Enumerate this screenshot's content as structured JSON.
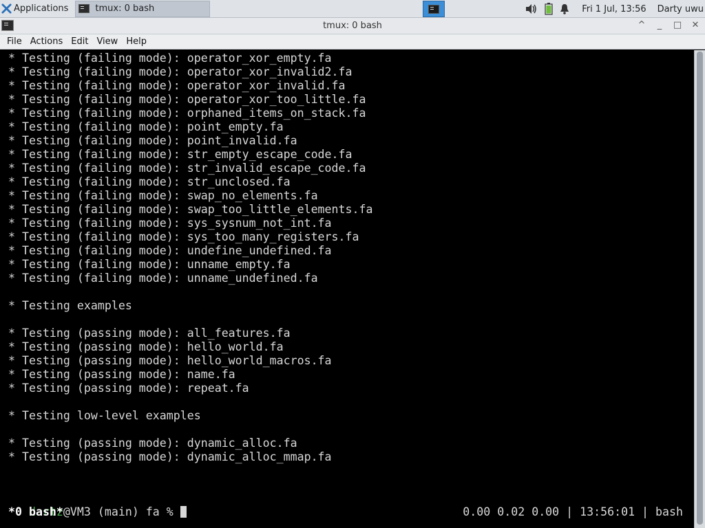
{
  "panel": {
    "apps_label": "Applications",
    "task_label": "tmux: 0 bash",
    "clock": "Fri  1 Jul, 13:56",
    "user": "Darty uwu",
    "icons": [
      "xfce-icon",
      "terminal-icon",
      "volume-icon",
      "battery-icon",
      "notification-bell-icon"
    ]
  },
  "window": {
    "title": "tmux: 0 bash",
    "controls": [
      "^",
      "_",
      "□",
      "✕"
    ]
  },
  "menu": {
    "items": [
      "File",
      "Actions",
      "Edit",
      "View",
      "Help"
    ]
  },
  "terminal": {
    "lines": [
      " * Testing (failing mode): operator_xor_empty.fa",
      " * Testing (failing mode): operator_xor_invalid2.fa",
      " * Testing (failing mode): operator_xor_invalid.fa",
      " * Testing (failing mode): operator_xor_too_little.fa",
      " * Testing (failing mode): orphaned_items_on_stack.fa",
      " * Testing (failing mode): point_empty.fa",
      " * Testing (failing mode): point_invalid.fa",
      " * Testing (failing mode): str_empty_escape_code.fa",
      " * Testing (failing mode): str_invalid_escape_code.fa",
      " * Testing (failing mode): str_unclosed.fa",
      " * Testing (failing mode): swap_no_elements.fa",
      " * Testing (failing mode): swap_too_little_elements.fa",
      " * Testing (failing mode): sys_sysnum_not_int.fa",
      " * Testing (failing mode): sys_too_many_registers.fa",
      " * Testing (failing mode): undefine_undefined.fa",
      " * Testing (failing mode): unname_empty.fa",
      " * Testing (failing mode): unname_undefined.fa",
      "",
      " * Testing examples",
      "",
      " * Testing (passing mode): all_features.fa",
      " * Testing (passing mode): hello_world.fa",
      " * Testing (passing mode): hello_world_macros.fa",
      " * Testing (passing mode): name.fa",
      " * Testing (passing mode): repeat.fa",
      "",
      " * Testing low-level examples",
      "",
      " * Testing (passing mode): dynamic_alloc.fa",
      " * Testing (passing mode): dynamic_alloc_mmap.fa",
      "",
      ""
    ],
    "prompt_user": "dartz",
    "prompt_rest": "@VM3 (main) fa % ",
    "status_left": " *0 bash*",
    "status_right": "0.00 0.02 0.00 | 13:56:01 | bash"
  }
}
